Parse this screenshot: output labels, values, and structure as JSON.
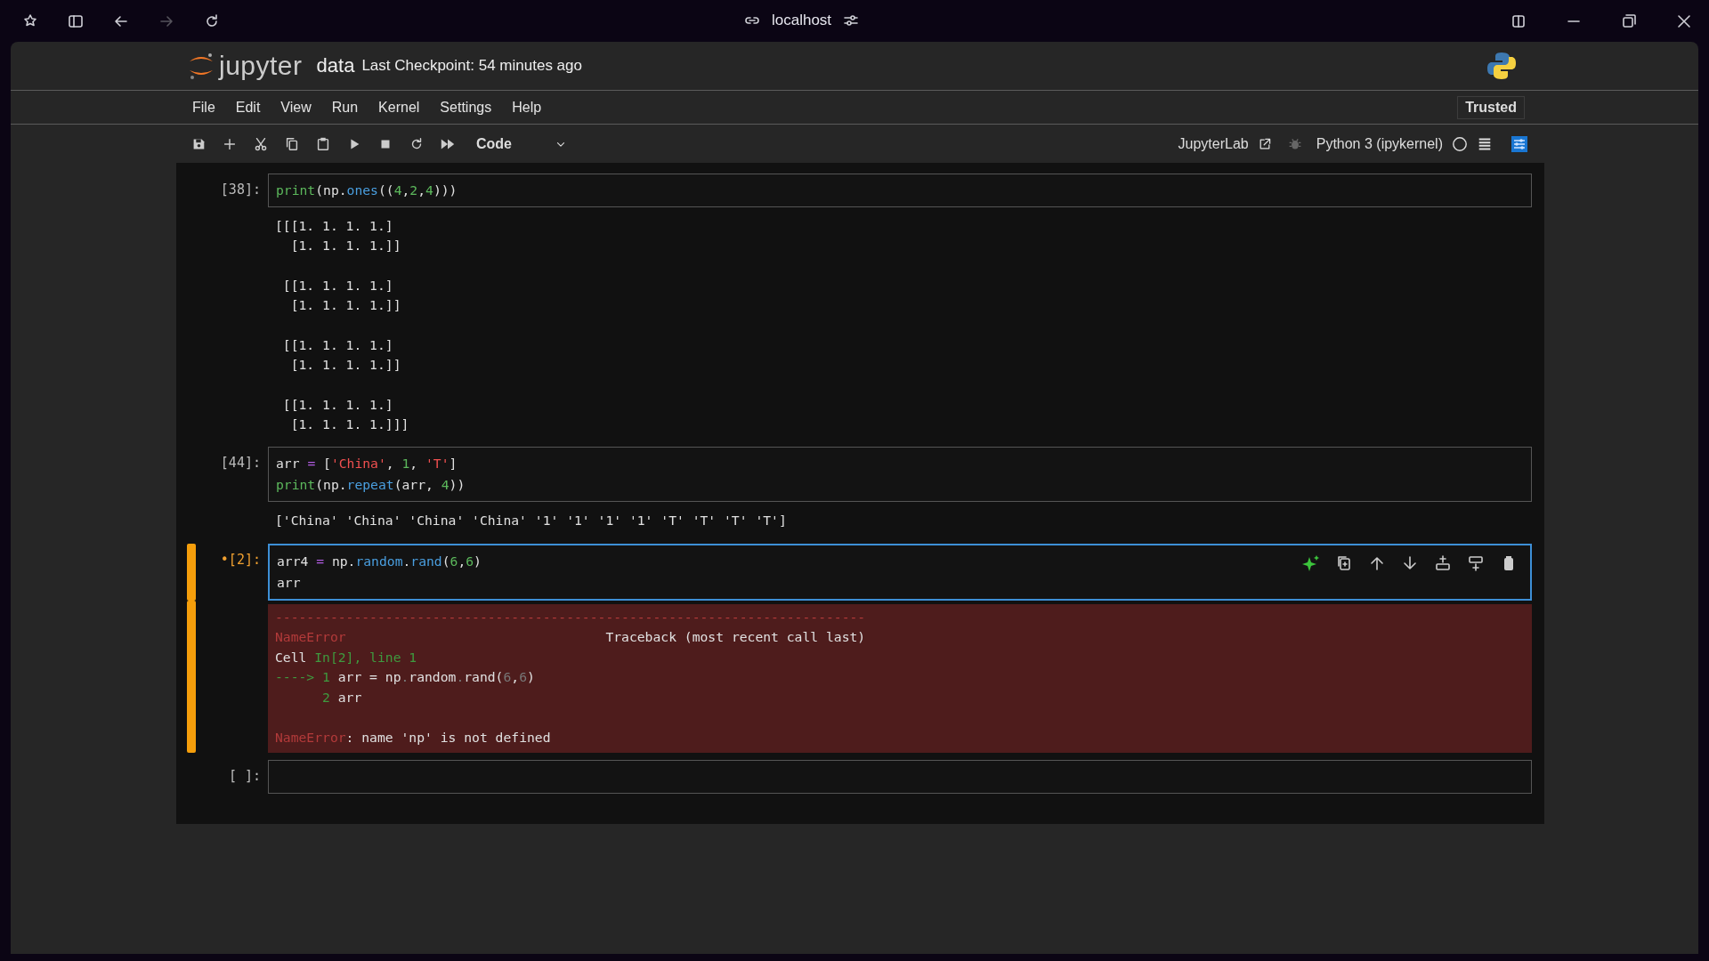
{
  "browser": {
    "address": "localhost"
  },
  "notebook": {
    "brand": "jupyter",
    "name": "data",
    "checkpoint": "Last Checkpoint: 54 minutes ago",
    "trusted": "Trusted"
  },
  "menu": [
    "File",
    "Edit",
    "View",
    "Run",
    "Kernel",
    "Settings",
    "Help"
  ],
  "toolbar": {
    "cell_type": "Code",
    "jupyterlab_link": "JupyterLab",
    "kernel": "Python 3 (ipykernel)"
  },
  "cells": [
    {
      "prompt": "[38]:",
      "active": false,
      "input": [
        {
          "text": "print",
          "kind": "builtin"
        },
        {
          "text": "(np.",
          "kind": "plain"
        },
        {
          "text": "ones",
          "kind": "attr"
        },
        {
          "text": "((",
          "kind": "plain"
        },
        {
          "text": "4",
          "kind": "num"
        },
        {
          "text": ",",
          "kind": "plain"
        },
        {
          "text": "2",
          "kind": "num"
        },
        {
          "text": ",",
          "kind": "plain"
        },
        {
          "text": "4",
          "kind": "num"
        },
        {
          "text": ")))",
          "kind": "plain"
        }
      ],
      "output": {
        "kind": "stream",
        "text": "[[[1. 1. 1. 1.]\n  [1. 1. 1. 1.]]\n\n [[1. 1. 1. 1.]\n  [1. 1. 1. 1.]]\n\n [[1. 1. 1. 1.]\n  [1. 1. 1. 1.]]\n\n [[1. 1. 1. 1.]\n  [1. 1. 1. 1.]]]"
      }
    },
    {
      "prompt": "[44]:",
      "active": false,
      "input": [
        {
          "text": "arr ",
          "kind": "plain"
        },
        {
          "text": "=",
          "kind": "op"
        },
        {
          "text": " [",
          "kind": "plain"
        },
        {
          "text": "'China'",
          "kind": "str"
        },
        {
          "text": ", ",
          "kind": "plain"
        },
        {
          "text": "1",
          "kind": "num"
        },
        {
          "text": ", ",
          "kind": "plain"
        },
        {
          "text": "'T'",
          "kind": "str"
        },
        {
          "text": "]\n",
          "kind": "plain"
        },
        {
          "text": "print",
          "kind": "builtin"
        },
        {
          "text": "(np.",
          "kind": "plain"
        },
        {
          "text": "repeat",
          "kind": "attr"
        },
        {
          "text": "(arr, ",
          "kind": "plain"
        },
        {
          "text": "4",
          "kind": "num"
        },
        {
          "text": "))",
          "kind": "plain"
        }
      ],
      "output": {
        "kind": "stream",
        "text": "['China' 'China' 'China' 'China' '1' '1' '1' '1' 'T' 'T' 'T' 'T']"
      }
    },
    {
      "prompt": "•[2]:",
      "active": true,
      "input": [
        {
          "text": "arr4 ",
          "kind": "plain"
        },
        {
          "text": "=",
          "kind": "op"
        },
        {
          "text": " np.",
          "kind": "plain"
        },
        {
          "text": "random",
          "kind": "attr"
        },
        {
          "text": ".",
          "kind": "plain"
        },
        {
          "text": "rand",
          "kind": "attr"
        },
        {
          "text": "(",
          "kind": "plain"
        },
        {
          "text": "6",
          "kind": "num"
        },
        {
          "text": ",",
          "kind": "plain"
        },
        {
          "text": "6",
          "kind": "num"
        },
        {
          "text": ")\narr",
          "kind": "plain"
        }
      ],
      "output": {
        "kind": "error",
        "tokens": [
          {
            "text": "---------------------------------------------------------------------------\nNameError",
            "kind": "err"
          },
          {
            "text": "                                 Traceback (most recent call last)\nCell ",
            "kind": "plain"
          },
          {
            "text": "In[2], line 1",
            "kind": "green"
          },
          {
            "text": "\n----> 1 ",
            "kind": "green"
          },
          {
            "text": "arr = np",
            "kind": "plain"
          },
          {
            "text": ".",
            "kind": "dim"
          },
          {
            "text": "random",
            "kind": "plain"
          },
          {
            "text": ".",
            "kind": "dim"
          },
          {
            "text": "rand(",
            "kind": "plain"
          },
          {
            "text": "6",
            "kind": "dim"
          },
          {
            "text": ",",
            "kind": "plain"
          },
          {
            "text": "6",
            "kind": "dim"
          },
          {
            "text": ")\n",
            "kind": "plain"
          },
          {
            "text": "      2 ",
            "kind": "green"
          },
          {
            "text": "arr\n\n",
            "kind": "plain"
          },
          {
            "text": "NameError",
            "kind": "err"
          },
          {
            "text": ": name 'np' is not defined",
            "kind": "plain"
          }
        ]
      }
    },
    {
      "prompt": "[ ]:",
      "active": false
    }
  ]
}
